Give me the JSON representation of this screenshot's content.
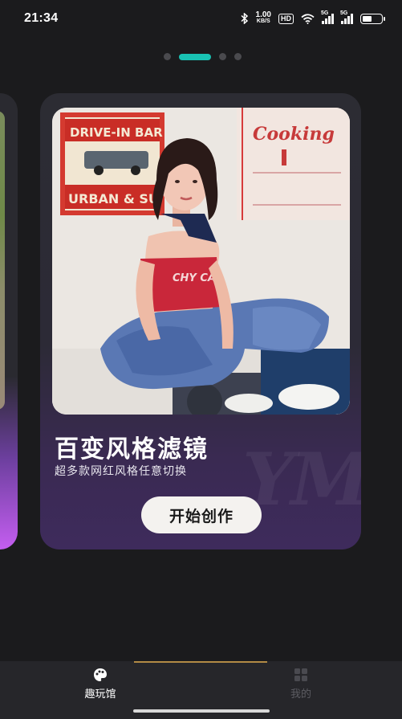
{
  "status_bar": {
    "time": "21:34",
    "net_speed_value": "1.00",
    "net_speed_unit": "KB/S",
    "hd_label": "HD",
    "sim1_label": "5G",
    "sim2_label": "5G",
    "battery_level": 0.5,
    "icons": [
      "bluetooth-icon",
      "wifi-icon",
      "signal-icon",
      "battery-icon"
    ]
  },
  "pager": {
    "count": 4,
    "active_index": 1,
    "active_color": "#19c2b3"
  },
  "card": {
    "title": "百变风格滤镜",
    "subtitle": "超多款网红风格任意切换",
    "button_label": "开始创作",
    "watermark": "YM",
    "photo_sign_left": "DRIVE-IN BAR",
    "photo_sign_left_2": "URBAN & SU",
    "photo_sign_right": "Cooking",
    "photo_tank_text": "CHY CA"
  },
  "tab_bar": {
    "tabs": [
      {
        "label": "趣玩馆",
        "icon": "palette-icon",
        "active": true
      },
      {
        "label": "我的",
        "icon": "grid-icon",
        "active": false
      }
    ],
    "indicator_color": "#b28a45"
  }
}
